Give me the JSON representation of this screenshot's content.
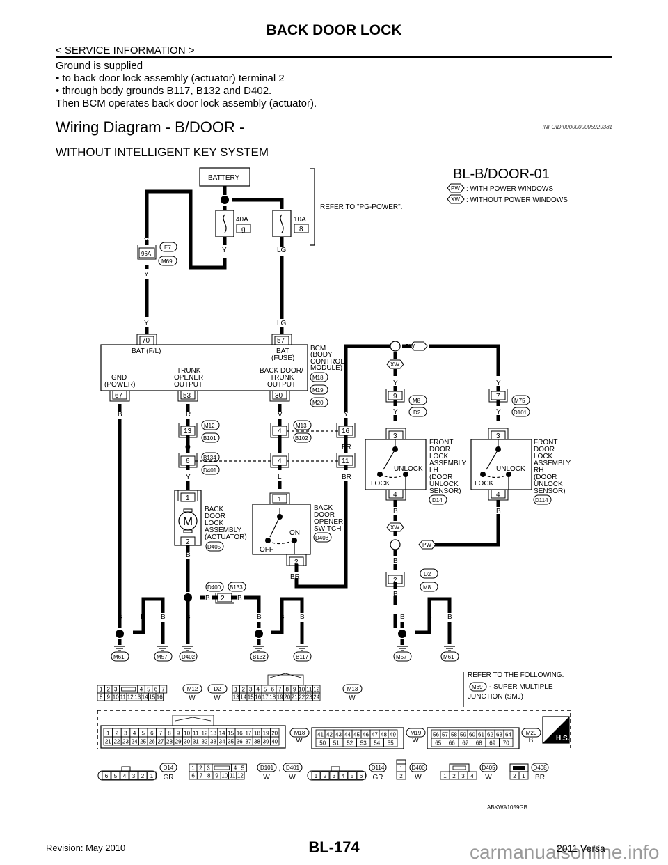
{
  "header": {
    "title": "BACK DOOR LOCK",
    "section_tag": "< SERVICE INFORMATION >"
  },
  "intro": {
    "lines": [
      "Ground is supplied",
      "•  to back door lock assembly (actuator) terminal 2",
      "•  through body grounds B117, B132 and D402.",
      "Then BCM operates back door lock assembly (actuator)."
    ]
  },
  "section": {
    "heading": "Wiring Diagram - B/DOOR -",
    "infoid": "INFOID:0000000005929381",
    "subheading": "WITHOUT INTELLIGENT KEY SYSTEM"
  },
  "diagram": {
    "code": "BL-B/DOOR-01",
    "legend": [
      {
        "tag": "PW",
        "text": ": WITH POWER WINDOWS"
      },
      {
        "tag": "XW",
        "text": ": WITHOUT POWER WINDOWS"
      }
    ],
    "battery": "BATTERY",
    "refer_power": "REFER TO \"PG-POWER\".",
    "fuses": [
      {
        "rating": "40A",
        "number": "g",
        "wire_out": "Y"
      },
      {
        "rating": "10A",
        "number": "8",
        "wire_out": "LG"
      }
    ],
    "smj": {
      "pin": "96A",
      "connectors": [
        "E7",
        "M69"
      ],
      "wire_in": "Y",
      "wire_out": "Y"
    },
    "bcm": {
      "name_lines": [
        "BCM",
        "(BODY",
        "CONTROL",
        "MODULE)"
      ],
      "connectors": [
        "M18",
        "M19",
        "M20"
      ],
      "pins_top": [
        {
          "pin": "70",
          "label": "BAT (F/L)",
          "wire": "Y"
        },
        {
          "pin": "57",
          "label_lines": [
            "BAT",
            "(FUSE)"
          ],
          "wire": "LG"
        }
      ],
      "pins_bottom": [
        {
          "pin": "67",
          "label_lines": [
            "GND",
            "(POWER)"
          ],
          "wire": "B"
        },
        {
          "pin": "53",
          "label_lines": [
            "TRUNK",
            "OPENER",
            "OUTPUT"
          ],
          "wire": "R"
        },
        {
          "pin": "30",
          "label_lines": [
            "BACK DOOR/",
            "TRUNK",
            "OUTPUT"
          ],
          "wire": "V"
        }
      ]
    },
    "inline_connectors": [
      {
        "pin": "13",
        "connectors": [
          "M12",
          "B101"
        ],
        "wire_in": "R",
        "wire_out": "O"
      },
      {
        "pin": "6",
        "connectors": [
          "B134",
          "D401"
        ],
        "wire_in": "O",
        "wire_out": "Y"
      },
      {
        "pin": "4",
        "connectors": [
          "M13",
          "B102"
        ],
        "wire_in": "V",
        "wire_out": "L"
      },
      {
        "pin": "4",
        "wire_in": "L",
        "wire_out": "L"
      },
      {
        "pin": "16",
        "wire_in": "Y",
        "wire_out": "BR"
      },
      {
        "pin": "11",
        "wire_in": "BR",
        "wire_out": "BR"
      },
      {
        "pin": "9",
        "connectors": [
          "M8",
          "D2"
        ],
        "wire_in": "Y",
        "wire_out": "Y"
      },
      {
        "pin": "7",
        "connectors": [
          "M75",
          "D101"
        ],
        "wire_in": "Y",
        "wire_out": "Y"
      },
      {
        "pin": "2",
        "connectors": [
          "D2",
          "M8"
        ],
        "wire_in": "B",
        "wire_out": "B"
      },
      {
        "pin": "2",
        "connectors": [
          "D400",
          "B133"
        ],
        "wire_in": "B",
        "wire_out": "B"
      }
    ],
    "components": {
      "actuator": {
        "lines": [
          "BACK",
          "DOOR",
          "LOCK",
          "ASSEMBLY",
          "(ACTUATOR)"
        ],
        "connector": "D405",
        "pin_top": "1",
        "pin_bottom": "2",
        "symbol": "M"
      },
      "opener_switch": {
        "lines": [
          "BACK",
          "DOOR",
          "OPENER",
          "SWITCH"
        ],
        "connector": "D408",
        "pin_top": "1",
        "pin_bottom": "2",
        "on": "ON",
        "off": "OFF"
      },
      "front_lh": {
        "lines": [
          "FRONT",
          "DOOR",
          "LOCK",
          "ASSEMBLY",
          "LH",
          "(DOOR",
          "UNLOCK",
          "SENSOR)"
        ],
        "connector": "D14",
        "pin_top": "3",
        "pin_bottom": "4",
        "unlock": "UNLOCK",
        "lock": "LOCK"
      },
      "front_rh": {
        "lines": [
          "FRONT",
          "DOOR",
          "LOCK",
          "ASSEMBLY",
          "RH",
          "(DOOR",
          "UNLOCK",
          "SENSOR)"
        ],
        "connector": "D114",
        "pin_top": "3",
        "pin_bottom": "4",
        "unlock": "UNLOCK",
        "lock": "LOCK"
      }
    },
    "wire_colors": {
      "Y": "Y",
      "LG": "LG",
      "B": "B",
      "R": "R",
      "V": "V",
      "O": "O",
      "L": "L",
      "BR": "BR"
    },
    "grounds": [
      "M61",
      "M57",
      "D402",
      "B132",
      "B117",
      "M57",
      "M61"
    ],
    "refer_following": {
      "line1": "REFER TO THE FOLLOWING.",
      "connector": "M69",
      "line2": "- SUPER MULTIPLE",
      "line3": "JUNCTION (SMJ)"
    },
    "connector_views": {
      "m12_d2": {
        "top": [
          "1",
          "2",
          "3",
          "",
          "4",
          "5",
          "6",
          "7"
        ],
        "bottom": [
          "8",
          "9",
          "10",
          "11",
          "12",
          "13",
          "14",
          "15",
          "16"
        ],
        "ids": [
          "M12",
          "D2"
        ],
        "colors": [
          "W",
          "W"
        ]
      },
      "m13": {
        "top": [
          "1",
          "2",
          "3",
          "4",
          "5",
          "6",
          "7",
          "8",
          "9",
          "10",
          "11",
          "12"
        ],
        "bottom": [
          "13",
          "14",
          "15",
          "16",
          "17",
          "18",
          "19",
          "20",
          "21",
          "22",
          "23",
          "24"
        ],
        "id": "M13",
        "color": "W"
      },
      "m18": {
        "top": [
          "1",
          "2",
          "3",
          "4",
          "5",
          "6",
          "7",
          "8",
          "9",
          "10",
          "11",
          "12",
          "13",
          "14",
          "15",
          "16",
          "17",
          "18",
          "19",
          "20"
        ],
        "bottom": [
          "21",
          "22",
          "23",
          "24",
          "25",
          "26",
          "27",
          "28",
          "29",
          "30",
          "31",
          "32",
          "33",
          "34",
          "35",
          "36",
          "37",
          "38",
          "39",
          "40"
        ],
        "id": "M18",
        "color": "W"
      },
      "m19": {
        "top": [
          "41",
          "42",
          "43",
          "44",
          "45",
          "46",
          "47",
          "48",
          "49"
        ],
        "bottom": [
          "50",
          "51",
          "52",
          "53",
          "54",
          "55"
        ],
        "id": "M19",
        "color": "W"
      },
      "m20": {
        "top": [
          "56",
          "57",
          "58",
          "59",
          "60",
          "61",
          "62",
          "63",
          "64"
        ],
        "bottom": [
          "65",
          "66",
          "67",
          "68",
          "69",
          "70"
        ],
        "id": "M20",
        "color": "B"
      },
      "hs_badge": "H.S.",
      "d14": {
        "pins": [
          "6",
          "5",
          "4",
          "3",
          "2",
          "1"
        ],
        "id": "D14",
        "color": "GR"
      },
      "d101_d401": {
        "top": [
          "1",
          "2",
          "3",
          "",
          "4",
          "5"
        ],
        "bottom": [
          "6",
          "7",
          "8",
          "9",
          "10",
          "11",
          "12"
        ],
        "ids": [
          "D101",
          "D401"
        ],
        "colors": [
          "W",
          "W"
        ]
      },
      "d114": {
        "pins": [
          "1",
          "2",
          "3",
          "4",
          "5",
          "6"
        ],
        "id": "D114",
        "color": "GR"
      },
      "d400": {
        "pins": [
          "1",
          "2"
        ],
        "id": "D400",
        "color": "W"
      },
      "d405": {
        "pins": [
          "1",
          "2",
          "3",
          "4"
        ],
        "id": "D405",
        "color": "W"
      },
      "d408": {
        "pins": [
          "2",
          "1"
        ],
        "id": "D408",
        "color": "BR"
      }
    },
    "figure_code": "ABKWA1059GB"
  },
  "footer": {
    "revision": "Revision: May 2010",
    "page": "BL-174",
    "model": "2011 Versa",
    "watermark": "carmanualsonline.info"
  }
}
